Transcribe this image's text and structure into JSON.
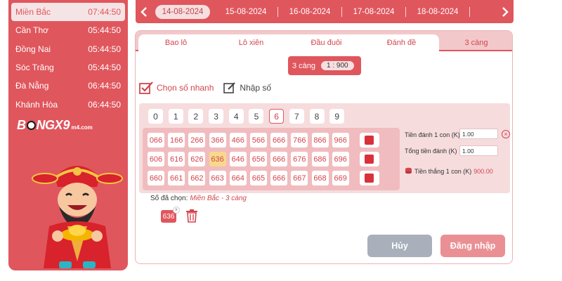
{
  "regions": [
    {
      "name": "Miền Bắc",
      "time": "07:44:50",
      "active": true
    },
    {
      "name": "Cần Thơ",
      "time": "05:44:50",
      "active": false
    },
    {
      "name": "Đồng Nai",
      "time": "05:44:50",
      "active": false
    },
    {
      "name": "Sóc Trăng",
      "time": "05:44:50",
      "active": false
    },
    {
      "name": "Đà Nẵng",
      "time": "06:44:50",
      "active": false
    },
    {
      "name": "Khánh Hòa",
      "time": "06:44:50",
      "active": false
    }
  ],
  "logo": {
    "part1": "B",
    "part2": "NG",
    "part3": "X9",
    "part4": "m4.com"
  },
  "dates": [
    "14-08-2024",
    "15-08-2024",
    "16-08-2024",
    "17-08-2024",
    "18-08-2024"
  ],
  "active_date": "14-08-2024",
  "tabs": [
    "Bao lô",
    "Lô xiên",
    "Đầu đuôi",
    "Đánh đề",
    "3 càng"
  ],
  "active_tab": "3 càng",
  "mode": {
    "label": "3 càng",
    "ratio": "1 : 900"
  },
  "quick": {
    "fast_pick": "Chọn số nhanh",
    "manual_entry": "Nhập số"
  },
  "digits": [
    "0",
    "1",
    "2",
    "3",
    "4",
    "5",
    "6",
    "7",
    "8",
    "9"
  ],
  "active_digit": "6",
  "grid": [
    [
      "066",
      "166",
      "266",
      "366",
      "466",
      "566",
      "666",
      "766",
      "866",
      "966"
    ],
    [
      "606",
      "616",
      "626",
      "636",
      "646",
      "656",
      "666",
      "676",
      "686",
      "696"
    ],
    [
      "660",
      "661",
      "662",
      "663",
      "664",
      "665",
      "666",
      "667",
      "668",
      "669"
    ]
  ],
  "selected_number": "636",
  "form": {
    "bet_per_label": "Tiền đánh 1 con (K)",
    "bet_per_value": "1.00",
    "total_label": "Tổng tiền đánh (K)",
    "total_value": "1.00",
    "win_label": "Tiền thắng 1 con (K)",
    "win_value": "900.00"
  },
  "chosen": {
    "label": "Số đã chọn:",
    "detail": "Miền Bắc - 3 càng",
    "numbers": [
      "636"
    ]
  },
  "buttons": {
    "cancel": "Hủy",
    "login": "Đăng nhập"
  },
  "colors": {
    "primary": "#e0565d",
    "accent_text": "#d2464e",
    "selected": "#f8d98c",
    "cancel": "#a9b0bc",
    "login": "#ea8f93"
  }
}
